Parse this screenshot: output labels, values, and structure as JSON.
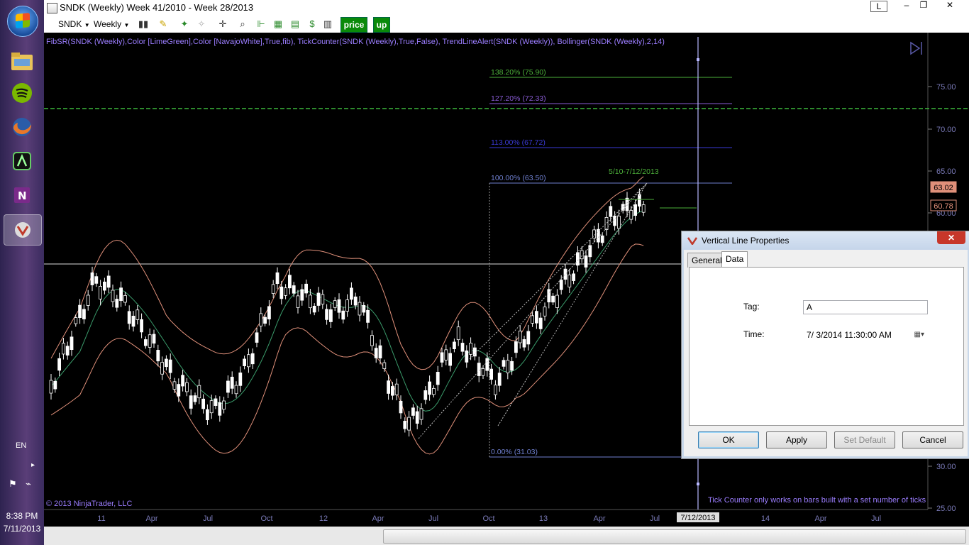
{
  "window": {
    "title": "SNDK (Weekly)  Week 41/2010 - Week 28/2013",
    "ctl_l": "L",
    "ctl_min": "–",
    "ctl_max": "❐",
    "ctl_close": "✕"
  },
  "toolbar": {
    "instrument": "SNDK",
    "period": "Weekly",
    "price_label": "price",
    "up_label": "up"
  },
  "chart": {
    "indicators": "FibSR(SNDK (Weekly),Color [LimeGreen],Color [NavajoWhite],True,fib), TickCounter(SNDK (Weekly),True,False), TrendLineAlert(SNDK (Weekly)), Bollinger(SNDK (Weekly),2,14)",
    "copyright": "© 2013 NinjaTrader, LLC",
    "tick_counter_msg": "Tick Counter only works on bars built with a set number of ticks",
    "fib_levels": [
      {
        "label": "138.20% (75.90)",
        "value": 75.9,
        "color": "#4caf3a"
      },
      {
        "label": "127.20% (72.33)",
        "value": 72.33,
        "color": "#8a5cd6"
      },
      {
        "label": "113.00% (67.72)",
        "value": 67.72,
        "color": "#3a3ad6"
      },
      {
        "label": "100.00% (63.50)",
        "value": 63.5,
        "color": "#6f7fcf"
      },
      {
        "label": "0.00% (31.03)",
        "value": 31.03,
        "color": "#6f7fcf"
      }
    ],
    "trend_label": "5/10-7/12/2013",
    "price_axis": [
      "75.00",
      "70.00",
      "65.00",
      "60.00",
      "30.00",
      "25.00"
    ],
    "price_tags": [
      {
        "label": "63.02",
        "value": 63.02,
        "bg": "#e0907a"
      },
      {
        "label": "60.78",
        "value": 60.78,
        "bg": "#000000"
      }
    ],
    "time_axis": [
      "11",
      "Apr",
      "Jul",
      "Oct",
      "12",
      "Apr",
      "Jul",
      "Oct",
      "13",
      "Apr",
      "Jul",
      "14",
      "Apr",
      "Jul"
    ],
    "cursor_date": "7/12/2013"
  },
  "dialog": {
    "title": "Vertical Line Properties",
    "close": "✕",
    "tabs": [
      "General",
      "Data"
    ],
    "tag_label": "Tag:",
    "tag_value": "A",
    "time_label": "Time:",
    "time_value": "7/  3/2014 11:30:00 AM",
    "buttons": {
      "ok": "OK",
      "apply": "Apply",
      "set_default": "Set Default",
      "cancel": "Cancel"
    }
  },
  "taskbar": {
    "language": "EN",
    "time": "8:38 PM",
    "date": "7/11/2013"
  }
}
